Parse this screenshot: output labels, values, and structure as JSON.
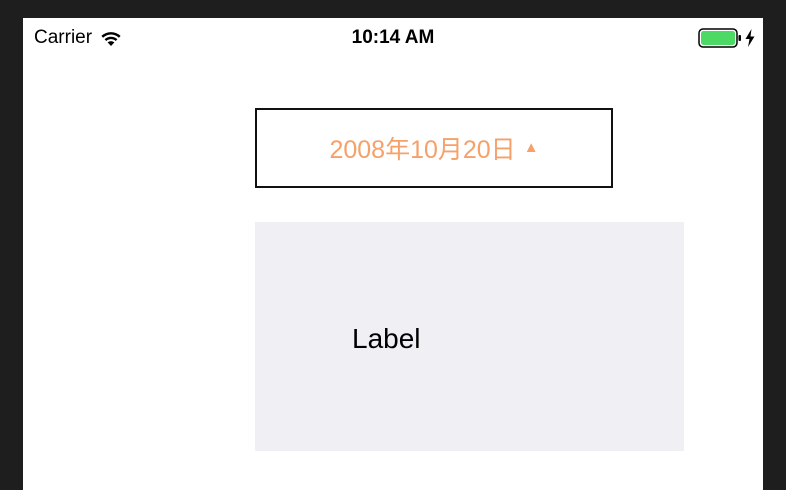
{
  "status_bar": {
    "carrier": "Carrier",
    "time": "10:14 AM",
    "wifi_icon": "wifi-icon",
    "battery_icon": "battery-icon",
    "charging_icon": "charging-bolt-icon",
    "battery_color": "#4cd964"
  },
  "date_picker": {
    "label": "2008年10月20日",
    "arrow": "▲",
    "accent_color": "#f6a06a"
  },
  "panel": {
    "label": "Label",
    "background": "#efeff4"
  }
}
